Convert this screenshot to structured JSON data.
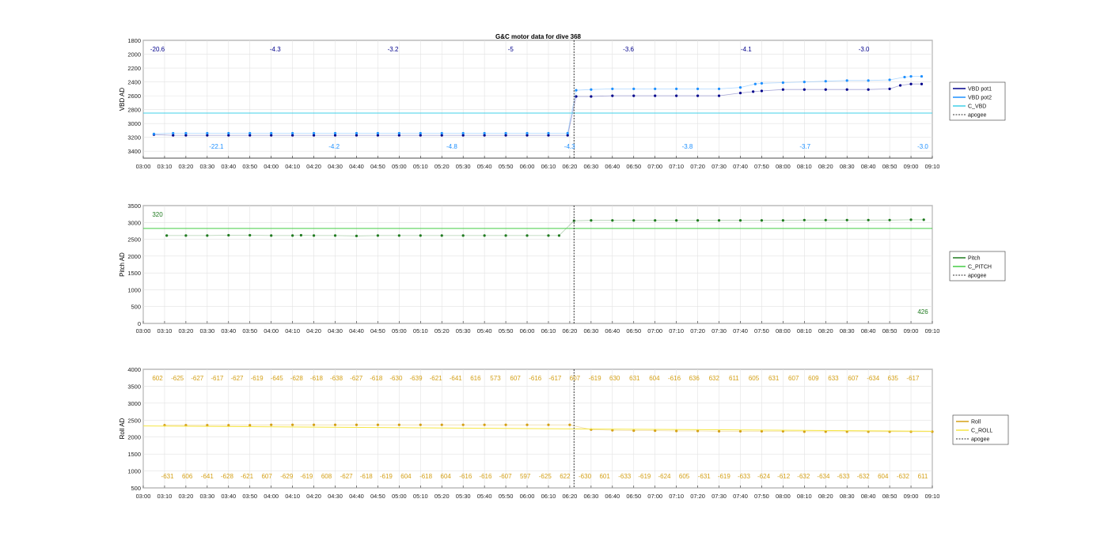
{
  "figure": {
    "title": "G&C motor data for dive 368"
  },
  "x_ticks": [
    "03:00",
    "03:10",
    "03:20",
    "03:30",
    "03:40",
    "03:50",
    "04:00",
    "04:10",
    "04:20",
    "04:30",
    "04:40",
    "04:50",
    "05:00",
    "05:10",
    "05:20",
    "05:30",
    "05:40",
    "05:50",
    "06:00",
    "06:10",
    "06:20",
    "06:30",
    "06:40",
    "06:50",
    "07:00",
    "07:10",
    "07:20",
    "07:30",
    "07:40",
    "07:50",
    "08:00",
    "08:10",
    "08:20",
    "08:30",
    "08:40",
    "08:50",
    "09:00",
    "09:10"
  ],
  "colors": {
    "vbd_pot1": "#00008b",
    "vbd_pot2": "#1e90ff",
    "c_vbd": "#40d0e8",
    "pitch": "#1f7a1f",
    "c_pitch": "#44cc44",
    "roll": "#d4a017",
    "c_roll": "#f5e642",
    "apogee": "#333333"
  },
  "chart_data": [
    {
      "type": "line",
      "title": "G&C motor data for dive 368",
      "ylabel": "VBD AD",
      "xlim": [
        "03:00",
        "09:10"
      ],
      "ylim": [
        3500,
        1800
      ],
      "y_reversed": true,
      "y_ticks": [
        "1800",
        "2000",
        "2200",
        "2400",
        "2600",
        "2800",
        "3000",
        "3200",
        "3400"
      ],
      "grid": true,
      "legend_position": "right",
      "apogee": "06:22",
      "series": [
        {
          "name": "VBD pot1",
          "x": [
            "03:05",
            "03:14",
            "03:20",
            "03:30",
            "03:40",
            "03:50",
            "04:00",
            "04:10",
            "04:20",
            "04:30",
            "04:40",
            "04:50",
            "05:00",
            "05:10",
            "05:20",
            "05:30",
            "05:40",
            "05:50",
            "06:00",
            "06:10",
            "06:19",
            "06:23",
            "06:30",
            "06:40",
            "06:50",
            "07:00",
            "07:10",
            "07:20",
            "07:30",
            "07:40",
            "07:46",
            "07:50",
            "08:00",
            "08:10",
            "08:20",
            "08:30",
            "08:40",
            "08:50",
            "08:55",
            "09:00",
            "09:05"
          ],
          "y": [
            3160,
            3170,
            3170,
            3170,
            3170,
            3170,
            3170,
            3170,
            3170,
            3170,
            3170,
            3170,
            3170,
            3170,
            3170,
            3170,
            3170,
            3170,
            3170,
            3170,
            3170,
            2610,
            2610,
            2600,
            2600,
            2600,
            2600,
            2600,
            2600,
            2560,
            2540,
            2530,
            2510,
            2510,
            2510,
            2510,
            2510,
            2500,
            2450,
            2430,
            2430
          ]
        },
        {
          "name": "VBD pot2",
          "x": [
            "03:05",
            "03:14",
            "03:20",
            "03:30",
            "03:40",
            "03:50",
            "04:00",
            "04:10",
            "04:20",
            "04:30",
            "04:40",
            "04:50",
            "05:00",
            "05:10",
            "05:20",
            "05:30",
            "05:40",
            "05:50",
            "06:00",
            "06:10",
            "06:19",
            "06:23",
            "06:30",
            "06:40",
            "06:50",
            "07:00",
            "07:10",
            "07:20",
            "07:30",
            "07:40",
            "07:47",
            "07:50",
            "08:00",
            "08:10",
            "08:20",
            "08:30",
            "08:40",
            "08:50",
            "08:57",
            "09:00",
            "09:05"
          ],
          "y": [
            3150,
            3140,
            3140,
            3140,
            3140,
            3140,
            3140,
            3140,
            3140,
            3140,
            3140,
            3140,
            3140,
            3140,
            3140,
            3140,
            3140,
            3140,
            3140,
            3140,
            3140,
            2520,
            2510,
            2500,
            2500,
            2500,
            2500,
            2500,
            2500,
            2480,
            2430,
            2420,
            2410,
            2400,
            2390,
            2380,
            2380,
            2370,
            2330,
            2320,
            2320
          ]
        },
        {
          "name": "C_VBD",
          "x": [
            "03:00",
            "09:10"
          ],
          "y": [
            2850,
            2850
          ]
        },
        {
          "name": "apogee",
          "x": [
            "06:22",
            "06:22"
          ],
          "y": [
            1800,
            3500
          ]
        }
      ],
      "annotations": [
        "-20.6",
        "-22.1",
        "-4.3",
        "-4.2",
        "-3.2",
        "-4.8",
        "-5",
        "-4.3",
        "-3.6",
        "-3.8",
        "-4.1",
        "-3.7",
        "-3.0",
        "-3.0"
      ]
    },
    {
      "type": "line",
      "ylabel": "Pitch AD",
      "xlim": [
        "03:00",
        "09:10"
      ],
      "ylim": [
        0,
        3500
      ],
      "y_ticks": [
        "0",
        "500",
        "1000",
        "1500",
        "2000",
        "2500",
        "3000",
        "3500"
      ],
      "grid": true,
      "legend_position": "right",
      "apogee": "06:22",
      "series": [
        {
          "name": "Pitch",
          "x": [
            "03:11",
            "03:20",
            "03:30",
            "03:40",
            "03:50",
            "04:00",
            "04:10",
            "04:14",
            "04:20",
            "04:30",
            "04:40",
            "04:50",
            "05:00",
            "05:10",
            "05:20",
            "05:30",
            "05:40",
            "05:50",
            "06:00",
            "06:10",
            "06:15",
            "06:22",
            "06:30",
            "06:40",
            "06:50",
            "07:00",
            "07:10",
            "07:20",
            "07:30",
            "07:40",
            "07:50",
            "08:00",
            "08:10",
            "08:20",
            "08:30",
            "08:40",
            "08:50",
            "09:00",
            "09:06"
          ],
          "y": [
            2610,
            2610,
            2610,
            2620,
            2620,
            2610,
            2610,
            2620,
            2610,
            2610,
            2600,
            2610,
            2610,
            2610,
            2610,
            2610,
            2610,
            2610,
            2610,
            2610,
            2610,
            3050,
            3060,
            3060,
            3060,
            3060,
            3060,
            3060,
            3060,
            3060,
            3060,
            3060,
            3070,
            3070,
            3070,
            3070,
            3070,
            3080,
            3080
          ]
        },
        {
          "name": "C_PITCH",
          "x": [
            "03:00",
            "09:10"
          ],
          "y": [
            2820,
            2820
          ]
        },
        {
          "name": "apogee",
          "x": [
            "06:22",
            "06:22"
          ],
          "y": [
            0,
            3500
          ]
        }
      ],
      "annotations": [
        "320",
        "426"
      ]
    },
    {
      "type": "line",
      "ylabel": "Roll AD",
      "xlim": [
        "03:00",
        "09:10"
      ],
      "ylim": [
        500,
        4000
      ],
      "y_ticks": [
        "500",
        "1000",
        "1500",
        "2000",
        "2500",
        "3000",
        "3500",
        "4000"
      ],
      "grid": true,
      "legend_position": "right",
      "apogee": "06:22",
      "series": [
        {
          "name": "Roll",
          "x": [
            "03:10",
            "03:20",
            "03:30",
            "03:40",
            "03:50",
            "04:00",
            "04:10",
            "04:20",
            "04:30",
            "04:40",
            "04:50",
            "05:00",
            "05:10",
            "05:20",
            "05:30",
            "05:40",
            "05:50",
            "06:00",
            "06:10",
            "06:20",
            "06:30",
            "06:40",
            "06:50",
            "07:00",
            "07:10",
            "07:20",
            "07:30",
            "07:40",
            "07:50",
            "08:00",
            "08:10",
            "08:20",
            "08:30",
            "08:40",
            "08:50",
            "09:00",
            "09:10"
          ],
          "y": [
            2350,
            2350,
            2350,
            2350,
            2350,
            2360,
            2360,
            2360,
            2360,
            2360,
            2360,
            2360,
            2360,
            2360,
            2360,
            2360,
            2360,
            2360,
            2360,
            2360,
            2220,
            2200,
            2190,
            2190,
            2180,
            2180,
            2170,
            2170,
            2170,
            2170,
            2160,
            2160,
            2160,
            2160,
            2160,
            2160,
            2160
          ]
        },
        {
          "name": "C_ROLL",
          "x": [
            "03:00",
            "09:10"
          ],
          "y": [
            2330,
            2170
          ]
        },
        {
          "name": "apogee",
          "x": [
            "06:22",
            "06:22"
          ],
          "y": [
            500,
            4000
          ]
        }
      ],
      "annotations": [
        "602",
        "-631",
        "-625",
        "606",
        "-627",
        "-641",
        "-617",
        "-628",
        "-627",
        "-621",
        "-619",
        "607",
        "-645",
        "-629",
        "-628",
        "-619",
        "-618",
        "608",
        "-638",
        "-627",
        "-627",
        "-618",
        "-618",
        "-619",
        "-630",
        "604",
        "-639",
        "-618",
        "-621",
        "604",
        "-641",
        "-616",
        "616",
        "-616",
        "573",
        "-607",
        "607",
        "597",
        "-616",
        "-625",
        "-617",
        "622",
        "607",
        "-630",
        "-619",
        "601",
        "630",
        "-633",
        "631",
        "-619",
        "604",
        "-624",
        "-616",
        "605",
        "636",
        "-631",
        "632",
        "-619",
        "611",
        "-633",
        "605",
        "-624",
        "631",
        "-612",
        "607",
        "-632",
        "609",
        "-634",
        "633",
        "-633",
        "607",
        "-632",
        "-634",
        "604",
        "635",
        "-632",
        "-617",
        "611"
      ]
    }
  ]
}
